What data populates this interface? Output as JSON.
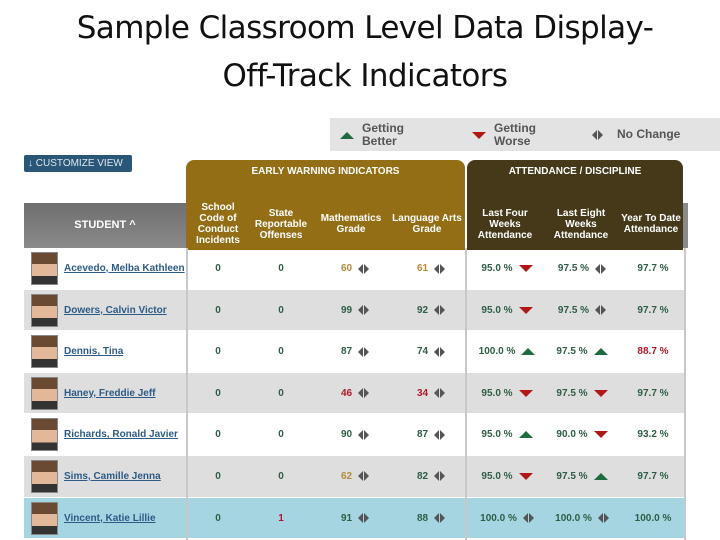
{
  "slide": {
    "title_line1": "Sample Classroom Level Data Display-",
    "title_line2": "Off-Track Indicators"
  },
  "legend": [
    {
      "icon": "triangle-up-icon",
      "label_line1": "Getting",
      "label_line2": "Better",
      "color": "#1e6b3f"
    },
    {
      "icon": "triangle-down-icon",
      "label_line1": "Getting",
      "label_line2": "Worse",
      "color": "#b01818"
    },
    {
      "icon": "no-change-arrows-icon",
      "label_line1": "No Change",
      "label_line2": "",
      "color": "#555555"
    }
  ],
  "toolbar": {
    "customize_label": "↓ CUSTOMIZE VIEW"
  },
  "groups": {
    "early_warning": "EARLY WARNING INDICATORS",
    "attendance": "ATTENDANCE / DISCIPLINE"
  },
  "columns": {
    "student": "STUDENT ^",
    "conduct": "School Code of Conduct Incidents",
    "offenses": "State Reportable Offenses",
    "math": "Mathematics Grade",
    "ela": "Language Arts Grade",
    "att4": "Last Four Weeks Attendance",
    "att8": "Last Eight Weeks Attendance",
    "ytd": "Year To Date Attendance"
  },
  "colors": {
    "ewi_header": "#936e15",
    "att_header": "#45391a",
    "good": "#2e5e45",
    "bad": "#b0182a",
    "warn": "#b48a3a",
    "selected_row": "#a6d5e2"
  },
  "students": [
    {
      "name": "Acevedo, Melba Kathleen",
      "conduct": "0",
      "offenses": "0",
      "math": "60",
      "math_status": "amber",
      "ela": "61",
      "ela_status": "amber",
      "att4": "95.0 %",
      "att4_trend": "down",
      "att8": "97.5 %",
      "att8_trend": "none",
      "ytd": "97.7 %",
      "ytd_status": "green"
    },
    {
      "name": "Dowers, Calvin Victor",
      "conduct": "0",
      "offenses": "0",
      "math": "99",
      "math_status": "green",
      "ela": "92",
      "ela_status": "green",
      "att4": "95.0 %",
      "att4_trend": "down",
      "att8": "97.5 %",
      "att8_trend": "none",
      "ytd": "97.7 %",
      "ytd_status": "green"
    },
    {
      "name": "Dennis, Tina",
      "conduct": "0",
      "offenses": "0",
      "math": "87",
      "math_status": "green",
      "ela": "74",
      "ela_status": "green",
      "att4": "100.0 %",
      "att4_trend": "up",
      "att8": "97.5 %",
      "att8_trend": "up",
      "ytd": "88.7 %",
      "ytd_status": "red"
    },
    {
      "name": "Haney, Freddie Jeff",
      "conduct": "0",
      "offenses": "0",
      "math": "46",
      "math_status": "red",
      "ela": "34",
      "ela_status": "red",
      "att4": "95.0 %",
      "att4_trend": "down",
      "att8": "97.5 %",
      "att8_trend": "down",
      "ytd": "97.7 %",
      "ytd_status": "green"
    },
    {
      "name": "Richards, Ronald Javier",
      "conduct": "0",
      "offenses": "0",
      "math": "90",
      "math_status": "green",
      "ela": "87",
      "ela_status": "green",
      "att4": "95.0 %",
      "att4_trend": "up",
      "att8": "90.0 %",
      "att8_trend": "down",
      "ytd": "93.2 %",
      "ytd_status": "green"
    },
    {
      "name": "Sims, Camille Jenna",
      "conduct": "0",
      "offenses": "0",
      "math": "62",
      "math_status": "amber",
      "ela": "82",
      "ela_status": "green",
      "att4": "95.0 %",
      "att4_trend": "down",
      "att8": "97.5 %",
      "att8_trend": "up",
      "ytd": "97.7 %",
      "ytd_status": "green"
    },
    {
      "name": "Vincent, Katie Lillie",
      "conduct": "0",
      "offenses": "1",
      "offenses_status": "red",
      "math": "91",
      "math_status": "green",
      "ela": "88",
      "ela_status": "green",
      "att4": "100.0 %",
      "att4_trend": "none",
      "att8": "100.0 %",
      "att8_trend": "none",
      "ytd": "100.0 %",
      "ytd_status": "green",
      "selected": true
    }
  ]
}
